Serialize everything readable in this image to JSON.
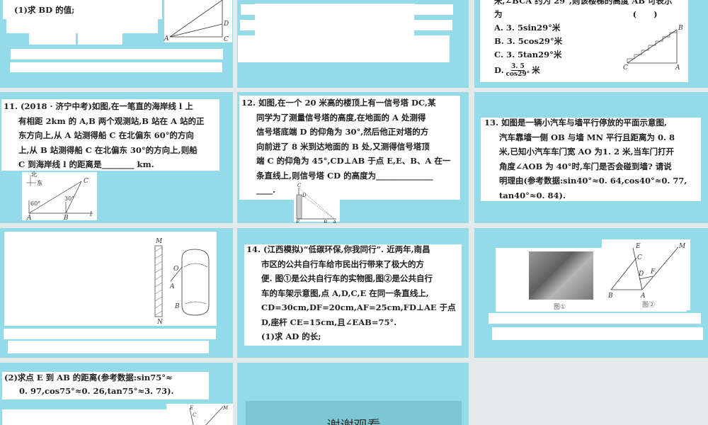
{
  "slides": [
    {
      "id": "s1",
      "lines": [
        "(1)求 BD 的值;"
      ],
      "fig_labels": [
        "A",
        "C",
        "D"
      ]
    },
    {
      "id": "s2"
    },
    {
      "id": "s3",
      "lines": [
        "米,∠BCA 约为 29°,则该楼梯的高度 AB 可表示",
        "为                                              (      )",
        "A. 3. 5sin29°米",
        "B. 3. 5cos29°米",
        "C. 3. 5tan29°米"
      ],
      "option_d": {
        "prefix": "D.",
        "num": "3. 5",
        "den": "cos29°",
        "suffix": "米"
      },
      "fig_labels": [
        "B",
        "C",
        "A"
      ]
    },
    {
      "id": "s11",
      "lines": [
        "11. (2018 · 济宁中考)如图,在一笔直的海岸线 l 上",
        "有相距 2km 的 A,B 两个观测站,B 站在 A 站的正",
        "东方向上,从 A 站测得船 C 在北偏东 60°的方向",
        "上,从 B 站测得船 C 在北偏东 30°的方向上,则船",
        "C 到海岸线 l 的距离是________ km."
      ],
      "fig_labels": [
        "北",
        "东",
        "C",
        "60°",
        "30°",
        "A",
        "B",
        "l"
      ]
    },
    {
      "id": "s12",
      "lines": [
        "12. 如图,在一个 20 米高的楼顶上有一信号塔 DC,某",
        "同学为了测量信号塔的高度,在地面的 A 处测得",
        "信号塔底端 D 的仰角为 30°,然后他正对塔的方",
        "向前进了 8 米到达地面的 B 处,又测得信号塔顶",
        "端 C 的仰角为 45°,CD⊥AB 于点 E,E、B、A 在一",
        "条直线上,则信号塔 CD 的高度为______________",
        "____."
      ],
      "fig_labels": [
        "C",
        "D",
        "E",
        "B",
        "A"
      ]
    },
    {
      "id": "s13",
      "lines": [
        "13. 如图是一辆小汽车与墙平行停放的平面示意图,",
        "汽车靠墙一侧 OB 与墙 MN 平行且距离为 0. 8",
        "米,已知小汽车车门宽 AO 为1. 2 米,当车门打开",
        "角度∠AOB 为 40°时,车门是否会碰到墙? 请说",
        "明理由(参考数据:sin40°≈0. 64,cos40°≈0. 77,",
        "tan40°≈0. 84)."
      ]
    },
    {
      "id": "s13b",
      "fig_labels": [
        "M",
        "N",
        "O",
        "A",
        "B"
      ]
    },
    {
      "id": "s14",
      "lines": [
        "14. (江西模拟)“低碳环保,你我同行”. 近两年,南昌",
        "市区的公共自行车给市民出行带来了极大的方",
        "便. 图①是公共自行车的实物图,图②是公共自行",
        "车的车架示意图,点 A,D,C,E 在同一条直线上,",
        "CD=30cm,DF=20cm,AF=25cm,FD⊥AE 于点",
        "D,座杆 CE=15cm,且∠EAB=75°.",
        "(1)求 AD 的长;"
      ]
    },
    {
      "id": "s14b",
      "fig_captions": [
        "图①",
        "图②"
      ],
      "fig_labels": [
        "E",
        "C",
        "M",
        "D",
        "F",
        "B",
        "A"
      ]
    },
    {
      "id": "s14c",
      "lines": [
        "(2)求点 E 到 AB 的距离(参考数据:sin75°≈",
        "0. 97,cos75°≈0. 26,tan75°≈3. 73)."
      ],
      "fig_labels": [
        "E",
        "C",
        "M"
      ]
    },
    {
      "id": "end",
      "title": "谢谢观看"
    }
  ],
  "colors": {
    "slide_bg": "#93dbe9",
    "gap": "#e4eaea",
    "end_box": "#7bc6d3"
  }
}
